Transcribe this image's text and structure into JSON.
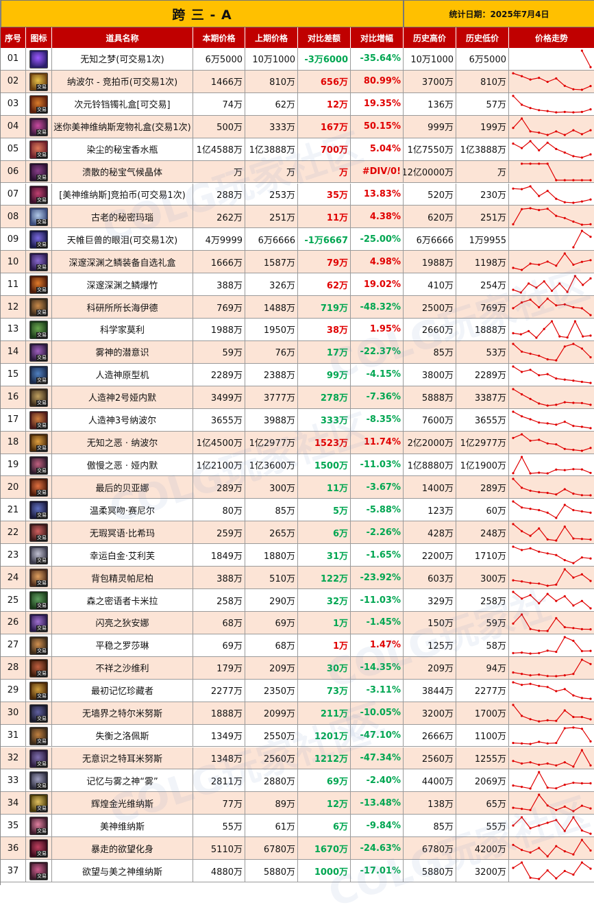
{
  "title": "跨 三 - A",
  "stat_date": "统计日期：2025年7月4日",
  "headers": [
    "序号",
    "图标",
    "道具名称",
    "本期价格",
    "上期价格",
    "对比差额",
    "对比增幅",
    "历史高价",
    "历史低价",
    "价格走势"
  ],
  "colors": {
    "title_bg": "#ffc000",
    "header_bg": "#c00000",
    "row_alt": "#fce4d6",
    "up": "#e00000",
    "down": "#00a651",
    "spark": "#e00000"
  },
  "icon_tag": "交易",
  "watermark": "COLG玩家社区",
  "rows": [
    {
      "idx": "01",
      "name": "无知之梦(可交易1次)",
      "cur": "6万5000",
      "prev": "10万1000",
      "diff": "-3万6000",
      "pct": "-35.64%",
      "dir": "down",
      "high": "10万1000",
      "low": "6万5000",
      "trend": [
        null,
        null,
        null,
        null,
        null,
        null,
        null,
        null,
        101000,
        65000
      ],
      "icon": [
        "#9b59ff",
        "#2b1f6b"
      ]
    },
    {
      "idx": "02",
      "name": "纳波尔 - 竞拍币(可交易1次)",
      "cur": "1466万",
      "prev": "810万",
      "diff": "656万",
      "pct": "80.99%",
      "dir": "up",
      "high": "3700万",
      "low": "810万",
      "trend": [
        3700,
        3200,
        2600,
        2900,
        2200,
        2800,
        1500,
        900,
        810,
        1466
      ],
      "icon": [
        "#e8c24a",
        "#6b3f10"
      ]
    },
    {
      "idx": "03",
      "name": "次元铃铛镯礼盒[可交易]",
      "cur": "74万",
      "prev": "62万",
      "diff": "12万",
      "pct": "19.35%",
      "dir": "up",
      "high": "136万",
      "low": "57万",
      "trend": [
        136,
        95,
        80,
        70,
        66,
        60,
        62,
        60,
        62,
        74
      ],
      "icon": [
        "#d97b2a",
        "#5a1e0c"
      ]
    },
    {
      "idx": "04",
      "name": "迷你美神维纳斯宠物礼盒(交易1次)",
      "cur": "500万",
      "prev": "333万",
      "diff": "167万",
      "pct": "50.15%",
      "dir": "up",
      "high": "999万",
      "low": "199万",
      "trend": [
        600,
        999,
        450,
        400,
        300,
        450,
        300,
        500,
        333,
        500
      ],
      "icon": [
        "#c94aa0",
        "#3a1a3a"
      ]
    },
    {
      "idx": "05",
      "name": "染尘的秘宝香水瓶",
      "cur": "1亿4588万",
      "prev": "1亿3888万",
      "diff": "700万",
      "pct": "5.04%",
      "dir": "up",
      "high": "1亿7550万",
      "low": "1亿3888万",
      "trend": [
        17000,
        16000,
        17550,
        15500,
        17200,
        15800,
        15000,
        14200,
        13888,
        14588
      ],
      "icon": [
        "#e07a5a",
        "#6a1f2a"
      ]
    },
    {
      "idx": "06",
      "name": "溃散的秘宝气候晶体",
      "cur": "万",
      "prev": "万",
      "diff": "万",
      "pct": "#DIV/0!",
      "dir": "up",
      "high": "12亿0000万",
      "low": "万",
      "trend": [
        null,
        10,
        10,
        10,
        10,
        0,
        0,
        0,
        0,
        0
      ],
      "icon": [
        "#8a3f8a",
        "#2a1030"
      ]
    },
    {
      "idx": "07",
      "name": "[美神维纳斯]竞拍币(可交易1次)",
      "cur": "288万",
      "prev": "253万",
      "diff": "35万",
      "pct": "13.83%",
      "dir": "up",
      "high": "520万",
      "low": "230万",
      "trend": [
        480,
        470,
        520,
        350,
        440,
        300,
        240,
        230,
        253,
        288
      ],
      "icon": [
        "#c04070",
        "#3a0f2a"
      ]
    },
    {
      "idx": "08",
      "name": "古老的秘密玛瑙",
      "cur": "262万",
      "prev": "251万",
      "diff": "11万",
      "pct": "4.38%",
      "dir": "up",
      "high": "620万",
      "low": "251万",
      "trend": [
        260,
        600,
        620,
        580,
        610,
        450,
        400,
        320,
        251,
        262
      ],
      "icon": [
        "#b0c8e8",
        "#3a4a7a"
      ]
    },
    {
      "idx": "09",
      "name": "天帷巨兽的眼泪(可交易1次)",
      "cur": "4万9999",
      "prev": "6万6666",
      "diff": "-1万6667",
      "pct": "-25.00%",
      "dir": "down",
      "high": "6万6666",
      "low": "1万9955",
      "trend": [
        null,
        null,
        null,
        null,
        null,
        null,
        null,
        20000,
        66666,
        49999
      ],
      "icon": [
        "#7a6ae0",
        "#1a1a4a"
      ]
    },
    {
      "idx": "10",
      "name": "深邃深渊之鳞装备自选礼盒",
      "cur": "1666万",
      "prev": "1587万",
      "diff": "79万",
      "pct": "4.98%",
      "dir": "up",
      "high": "1988万",
      "low": "1198万",
      "trend": [
        1300,
        1200,
        1500,
        1450,
        1600,
        1400,
        1988,
        1450,
        1587,
        1666
      ],
      "icon": [
        "#8a6ad0",
        "#2a1a4a"
      ]
    },
    {
      "idx": "11",
      "name": "深邃深渊之鳞爆竹",
      "cur": "388万",
      "prev": "326万",
      "diff": "62万",
      "pct": "19.02%",
      "dir": "up",
      "high": "410万",
      "low": "254万",
      "trend": [
        280,
        254,
        340,
        300,
        360,
        270,
        340,
        260,
        410,
        326,
        388
      ],
      "icon": [
        "#e07a2a",
        "#4a1a0a"
      ]
    },
    {
      "idx": "12",
      "name": "科研所所长海伊德",
      "cur": "769万",
      "prev": "1488万",
      "diff": "719万",
      "pct": "-48.32%",
      "dir": "down",
      "high": "2500万",
      "low": "769万",
      "trend": [
        1500,
        2100,
        2400,
        1600,
        2500,
        1800,
        1900,
        1600,
        1488,
        769
      ],
      "icon": [
        "#c88a4a",
        "#3a2a1a"
      ]
    },
    {
      "idx": "13",
      "name": "科学家莫利",
      "cur": "1988万",
      "prev": "1950万",
      "diff": "38万",
      "pct": "1.95%",
      "dir": "up",
      "high": "2660万",
      "low": "1888万",
      "trend": [
        2100,
        2050,
        2200,
        1888,
        2300,
        2660,
        1950,
        1900,
        2660,
        1950,
        1988
      ],
      "icon": [
        "#6aa84f",
        "#1a3a1a"
      ]
    },
    {
      "idx": "14",
      "name": "雾神的潜意识",
      "cur": "59万",
      "prev": "76万",
      "diff": "17万",
      "pct": "-22.37%",
      "dir": "down",
      "high": "85万",
      "low": "53万",
      "trend": [
        85,
        70,
        66,
        62,
        55,
        53,
        80,
        85,
        76,
        59
      ],
      "icon": [
        "#a060c0",
        "#2a1a3a"
      ]
    },
    {
      "idx": "15",
      "name": "人造神原型机",
      "cur": "2289万",
      "prev": "2388万",
      "diff": "99万",
      "pct": "-4.15%",
      "dir": "down",
      "high": "3800万",
      "low": "2289万",
      "trend": [
        3800,
        3300,
        3500,
        3000,
        3100,
        2700,
        2600,
        2500,
        2388,
        2289
      ],
      "icon": [
        "#5080c0",
        "#1a2a4a"
      ]
    },
    {
      "idx": "16",
      "name": "人造神2号娅内默",
      "cur": "3499万",
      "prev": "3777万",
      "diff": "278万",
      "pct": "-7.36%",
      "dir": "down",
      "high": "5888万",
      "low": "3387万",
      "trend": [
        5888,
        5100,
        4400,
        3700,
        3387,
        3500,
        3900,
        3800,
        3777,
        3499
      ],
      "icon": [
        "#c0a060",
        "#3a2a1a"
      ]
    },
    {
      "idx": "17",
      "name": "人造神3号纳波尔",
      "cur": "3655万",
      "prev": "3988万",
      "diff": "333万",
      "pct": "-8.35%",
      "dir": "down",
      "high": "7600万",
      "low": "3655万",
      "trend": [
        7600,
        6500,
        5800,
        5000,
        4800,
        4500,
        5200,
        4200,
        3988,
        3655
      ],
      "icon": [
        "#d08040",
        "#4a1a1a"
      ]
    },
    {
      "idx": "18",
      "name": "无知之恶 · 纳波尔",
      "cur": "1亿4500万",
      "prev": "1亿2977万",
      "diff": "1523万",
      "pct": "11.74%",
      "dir": "up",
      "high": "2亿2000万",
      "low": "1亿2977万",
      "trend": [
        20000,
        22000,
        18500,
        19000,
        17000,
        16500,
        14000,
        13500,
        12977,
        14500
      ],
      "icon": [
        "#e0a040",
        "#4a2a0a"
      ]
    },
    {
      "idx": "19",
      "name": "傲慢之恶 · 娅内默",
      "cur": "1亿2100万",
      "prev": "1亿3600万",
      "diff": "1500万",
      "pct": "-11.03%",
      "dir": "down",
      "high": "1亿8880万",
      "low": "1亿1900万",
      "trend": [
        12000,
        18880,
        11900,
        12200,
        11900,
        13500,
        13300,
        13700,
        13600,
        12100
      ],
      "icon": [
        "#c06080",
        "#2a1a2a"
      ]
    },
    {
      "idx": "20",
      "name": "最后的贝亚娜",
      "cur": "289万",
      "prev": "300万",
      "diff": "11万",
      "pct": "-3.67%",
      "dir": "down",
      "high": "1400万",
      "low": "289万",
      "trend": [
        1400,
        800,
        600,
        500,
        450,
        350,
        700,
        400,
        300,
        289
      ],
      "icon": [
        "#e07040",
        "#4a1a0a"
      ]
    },
    {
      "idx": "21",
      "name": "温柔冥吻·赛尼尔",
      "cur": "80万",
      "prev": "85万",
      "diff": "5万",
      "pct": "-5.88%",
      "dir": "down",
      "high": "123万",
      "low": "60万",
      "trend": [
        123,
        100,
        95,
        90,
        80,
        60,
        110,
        90,
        85,
        80
      ],
      "icon": [
        "#6070c0",
        "#1a1a3a"
      ]
    },
    {
      "idx": "22",
      "name": "无瑕冥语·比希玛",
      "cur": "259万",
      "prev": "265万",
      "diff": "6万",
      "pct": "-2.26%",
      "dir": "down",
      "high": "428万",
      "low": "248万",
      "trend": [
        428,
        350,
        300,
        380,
        260,
        248,
        400,
        270,
        265,
        259
      ],
      "icon": [
        "#d06060",
        "#3a1a1a"
      ]
    },
    {
      "idx": "23",
      "name": "幸运白金·艾利芙",
      "cur": "1849万",
      "prev": "1880万",
      "diff": "31万",
      "pct": "-1.65%",
      "dir": "down",
      "high": "2200万",
      "low": "1710万",
      "trend": [
        2200,
        2100,
        2150,
        2050,
        2000,
        1950,
        1800,
        1710,
        1880,
        1849
      ],
      "icon": [
        "#c0c0d0",
        "#3a3a4a"
      ]
    },
    {
      "idx": "24",
      "name": "背包精灵帕尼柏",
      "cur": "388万",
      "prev": "510万",
      "diff": "122万",
      "pct": "-23.92%",
      "dir": "down",
      "high": "603万",
      "low": "300万",
      "trend": [
        400,
        380,
        350,
        340,
        300,
        320,
        603,
        450,
        510,
        388
      ],
      "icon": [
        "#e0a060",
        "#4a2a1a"
      ]
    },
    {
      "idx": "25",
      "name": "森之密语者卡米拉",
      "cur": "258万",
      "prev": "290万",
      "diff": "32万",
      "pct": "-11.03%",
      "dir": "down",
      "high": "329万",
      "low": "258万",
      "trend": [
        329,
        300,
        315,
        280,
        320,
        290,
        310,
        270,
        290,
        258
      ],
      "icon": [
        "#60a060",
        "#1a3a1a"
      ]
    },
    {
      "idx": "26",
      "name": "闪亮之狄安娜",
      "cur": "68万",
      "prev": "69万",
      "diff": "1万",
      "pct": "-1.45%",
      "dir": "down",
      "high": "150万",
      "low": "59万",
      "trend": [
        100,
        150,
        70,
        60,
        59,
        130,
        80,
        75,
        69,
        68
      ],
      "icon": [
        "#a070d0",
        "#2a1a4a"
      ]
    },
    {
      "idx": "27",
      "name": "平稳之罗莎琳",
      "cur": "69万",
      "prev": "68万",
      "diff": "1万",
      "pct": "1.47%",
      "dir": "up",
      "high": "125万",
      "low": "58万",
      "trend": [
        60,
        62,
        58,
        60,
        70,
        65,
        125,
        110,
        68,
        69
      ],
      "icon": [
        "#d09050",
        "#3a2a1a"
      ]
    },
    {
      "idx": "28",
      "name": "不祥之沙维利",
      "cur": "179万",
      "prev": "209万",
      "diff": "30万",
      "pct": "-14.35%",
      "dir": "down",
      "high": "209万",
      "low": "94万",
      "trend": [
        120,
        110,
        100,
        105,
        95,
        94,
        100,
        110,
        209,
        179
      ],
      "icon": [
        "#c06040",
        "#3a1a0a"
      ]
    },
    {
      "idx": "29",
      "name": "最初记忆珍藏者",
      "cur": "2277万",
      "prev": "2350万",
      "diff": "73万",
      "pct": "-3.11%",
      "dir": "down",
      "high": "3844万",
      "low": "2277万",
      "trend": [
        3844,
        3600,
        3700,
        3500,
        3400,
        3000,
        3200,
        2600,
        2350,
        2277
      ],
      "icon": [
        "#d0a040",
        "#4a2a0a"
      ]
    },
    {
      "idx": "30",
      "name": "无墙界之特尔米努斯",
      "cur": "1888万",
      "prev": "2099万",
      "diff": "211万",
      "pct": "-10.05%",
      "dir": "down",
      "high": "3200万",
      "low": "1700万",
      "trend": [
        3200,
        2200,
        1900,
        1700,
        1800,
        1750,
        2700,
        2100,
        2099,
        1888
      ],
      "icon": [
        "#6060a0",
        "#1a1a2a"
      ]
    },
    {
      "idx": "31",
      "name": "失衡之洛佩斯",
      "cur": "1349万",
      "prev": "2550万",
      "diff": "1201万",
      "pct": "-47.10%",
      "dir": "down",
      "high": "2666万",
      "low": "1100万",
      "trend": [
        1200,
        1150,
        1100,
        1300,
        1150,
        1200,
        2600,
        2666,
        2550,
        1349
      ],
      "icon": [
        "#c08040",
        "#3a2a1a"
      ]
    },
    {
      "idx": "32",
      "name": "无意识之特耳米努斯",
      "cur": "1348万",
      "prev": "2560万",
      "diff": "1212万",
      "pct": "-47.34%",
      "dir": "down",
      "high": "2560万",
      "low": "1255万",
      "trend": [
        1700,
        1500,
        1600,
        1400,
        1500,
        1350,
        1600,
        1255,
        2560,
        1348
      ],
      "icon": [
        "#8070b0",
        "#2a1a3a"
      ]
    },
    {
      "idx": "33",
      "name": "记忆与雾之神“雾”",
      "cur": "2811万",
      "prev": "2880万",
      "diff": "69万",
      "pct": "-2.40%",
      "dir": "down",
      "high": "4400万",
      "low": "2069万",
      "trend": [
        2500,
        2300,
        2069,
        4400,
        2200,
        2100,
        2600,
        2880,
        2811,
        2811
      ],
      "icon": [
        "#a0a0c0",
        "#2a2a3a"
      ]
    },
    {
      "idx": "34",
      "name": "辉煌金光维纳斯",
      "cur": "77万",
      "prev": "89万",
      "diff": "12万",
      "pct": "-13.48%",
      "dir": "down",
      "high": "138万",
      "low": "65万",
      "trend": [
        80,
        75,
        70,
        138,
        90,
        70,
        85,
        65,
        89,
        77
      ],
      "icon": [
        "#e0c060",
        "#4a3a0a"
      ]
    },
    {
      "idx": "35",
      "name": "美神维纳斯",
      "cur": "55万",
      "prev": "61万",
      "diff": "6万",
      "pct": "-9.84%",
      "dir": "down",
      "high": "85万",
      "low": "55万",
      "trend": [
        70,
        85,
        65,
        70,
        75,
        80,
        60,
        85,
        61,
        55
      ],
      "icon": [
        "#e080a0",
        "#3a1a2a"
      ]
    },
    {
      "idx": "36",
      "name": "暴走的欲望化身",
      "cur": "5110万",
      "prev": "6780万",
      "diff": "1670万",
      "pct": "-24.63%",
      "dir": "down",
      "high": "6780万",
      "low": "4200万",
      "trend": [
        6000,
        5200,
        4800,
        5500,
        4200,
        5800,
        5000,
        4500,
        6780,
        5110
      ],
      "icon": [
        "#c04060",
        "#3a0a1a"
      ]
    },
    {
      "idx": "37",
      "name": "欲望与美之神维纳斯",
      "cur": "4880万",
      "prev": "5880万",
      "diff": "1000万",
      "pct": "-17.01%",
      "dir": "down",
      "high": "5880万",
      "low": "3200万",
      "trend": [
        5000,
        5880,
        3400,
        3200,
        4600,
        3300,
        4500,
        3900,
        5880,
        4880
      ],
      "icon": [
        "#d06090",
        "#3a1a2a"
      ]
    }
  ]
}
